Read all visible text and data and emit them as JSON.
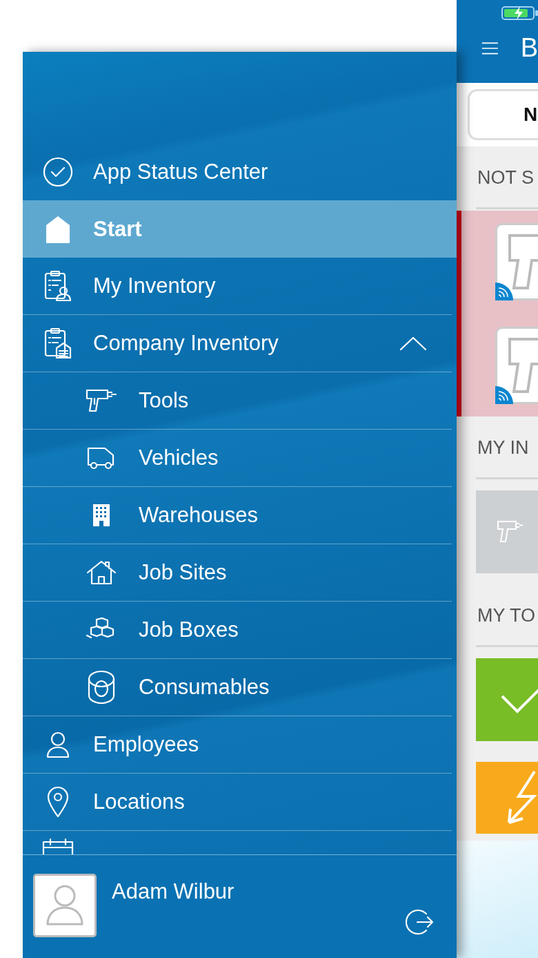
{
  "drawer": {
    "items": [
      {
        "label": "App Status Center",
        "selected": false
      },
      {
        "label": "Start",
        "selected": true
      },
      {
        "label": "My Inventory",
        "selected": false
      },
      {
        "label": "Company Inventory",
        "selected": false,
        "expanded": true,
        "children": [
          {
            "label": "Tools",
            "selected": false
          },
          {
            "label": "Vehicles",
            "selected": false
          },
          {
            "label": "Warehouses",
            "selected": false
          },
          {
            "label": "Job Sites",
            "selected": false
          },
          {
            "label": "Job Boxes",
            "selected": false
          },
          {
            "label": "Consumables",
            "selected": false
          }
        ]
      },
      {
        "label": "Employees",
        "selected": false
      },
      {
        "label": "Locations",
        "selected": false
      }
    ],
    "footer": {
      "user_name": "Adam Wilbur"
    }
  },
  "main": {
    "title": "B",
    "segment_label": "N",
    "sections": [
      {
        "heading": "NOT S",
        "kind": "alert",
        "tiles": [
          {
            "kind": "tool-photo"
          },
          {
            "kind": "tool-photo"
          }
        ]
      },
      {
        "heading": "MY IN",
        "kind": "normal",
        "tiles": [
          {
            "kind": "placeholder"
          }
        ]
      },
      {
        "heading": "MY TO",
        "kind": "normal",
        "tiles": [
          {
            "kind": "ok"
          },
          {
            "kind": "warning"
          }
        ]
      }
    ]
  }
}
